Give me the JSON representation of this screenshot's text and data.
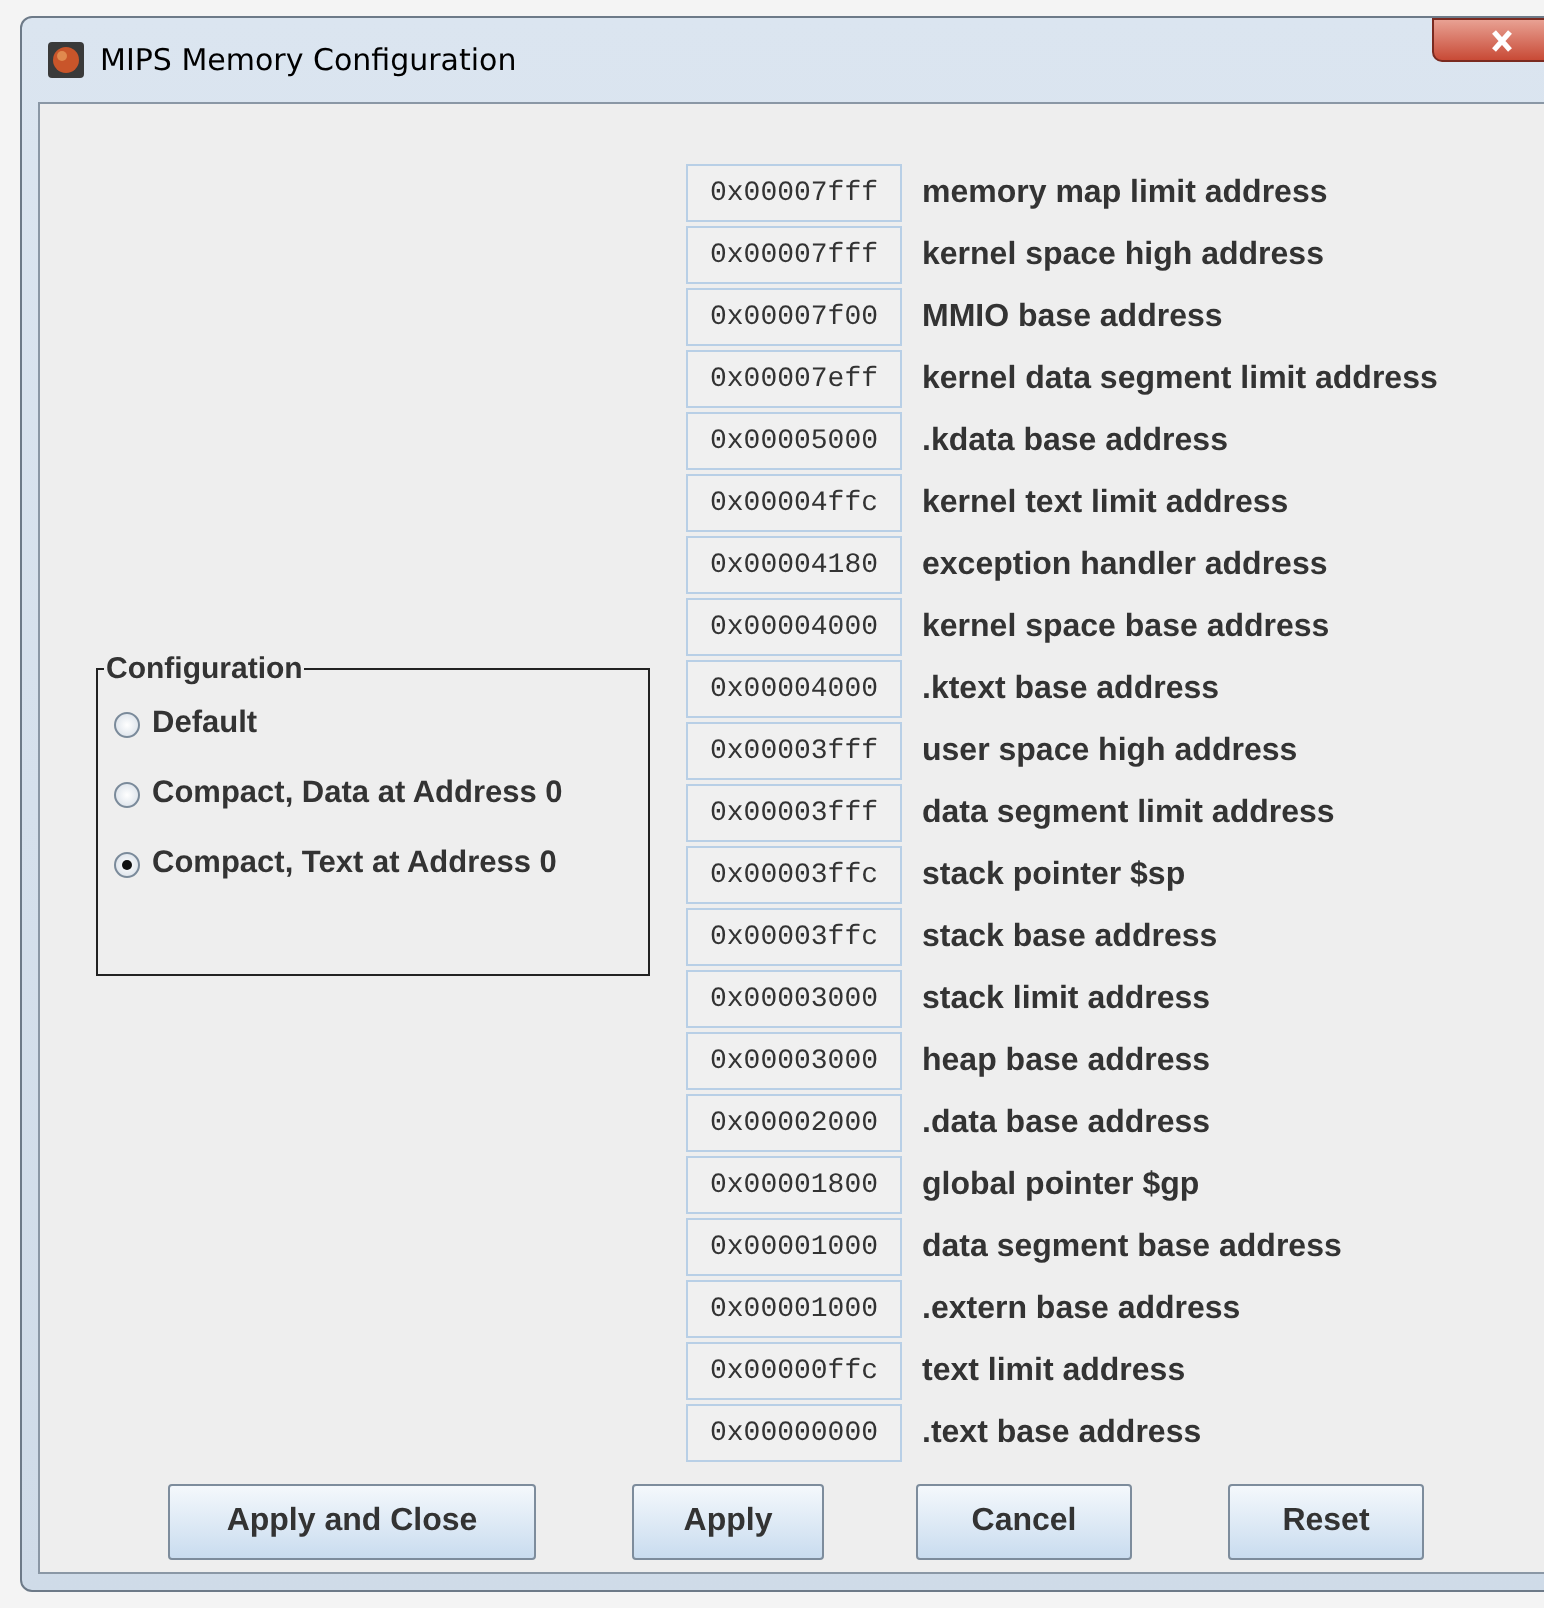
{
  "window": {
    "title": "MIPS Memory Configuration"
  },
  "configuration": {
    "title": "Configuration",
    "options": [
      {
        "label": "Default",
        "selected": false
      },
      {
        "label": "Compact, Data at Address 0",
        "selected": false
      },
      {
        "label": "Compact, Text at Address 0",
        "selected": true
      }
    ]
  },
  "addresses": [
    {
      "value": "0x00007fff",
      "label": "memory map limit address"
    },
    {
      "value": "0x00007fff",
      "label": "kernel space high address"
    },
    {
      "value": "0x00007f00",
      "label": "MMIO base address"
    },
    {
      "value": "0x00007eff",
      "label": "kernel data segment limit address"
    },
    {
      "value": "0x00005000",
      "label": ".kdata base address"
    },
    {
      "value": "0x00004ffc",
      "label": "kernel text limit address"
    },
    {
      "value": "0x00004180",
      "label": "exception handler address"
    },
    {
      "value": "0x00004000",
      "label": "kernel space base address"
    },
    {
      "value": "0x00004000",
      "label": ".ktext base address"
    },
    {
      "value": "0x00003fff",
      "label": "user space high address"
    },
    {
      "value": "0x00003fff",
      "label": "data segment limit address"
    },
    {
      "value": "0x00003ffc",
      "label": "stack pointer $sp"
    },
    {
      "value": "0x00003ffc",
      "label": "stack base address"
    },
    {
      "value": "0x00003000",
      "label": "stack limit address"
    },
    {
      "value": "0x00003000",
      "label": "heap base address"
    },
    {
      "value": "0x00002000",
      "label": ".data base address"
    },
    {
      "value": "0x00001800",
      "label": "global pointer $gp"
    },
    {
      "value": "0x00001000",
      "label": "data segment base address"
    },
    {
      "value": "0x00001000",
      "label": ".extern base address"
    },
    {
      "value": "0x00000ffc",
      "label": "text limit address"
    },
    {
      "value": "0x00000000",
      "label": ".text base address"
    }
  ],
  "buttons": [
    "Apply and Close",
    "Apply",
    "Cancel",
    "Reset"
  ]
}
